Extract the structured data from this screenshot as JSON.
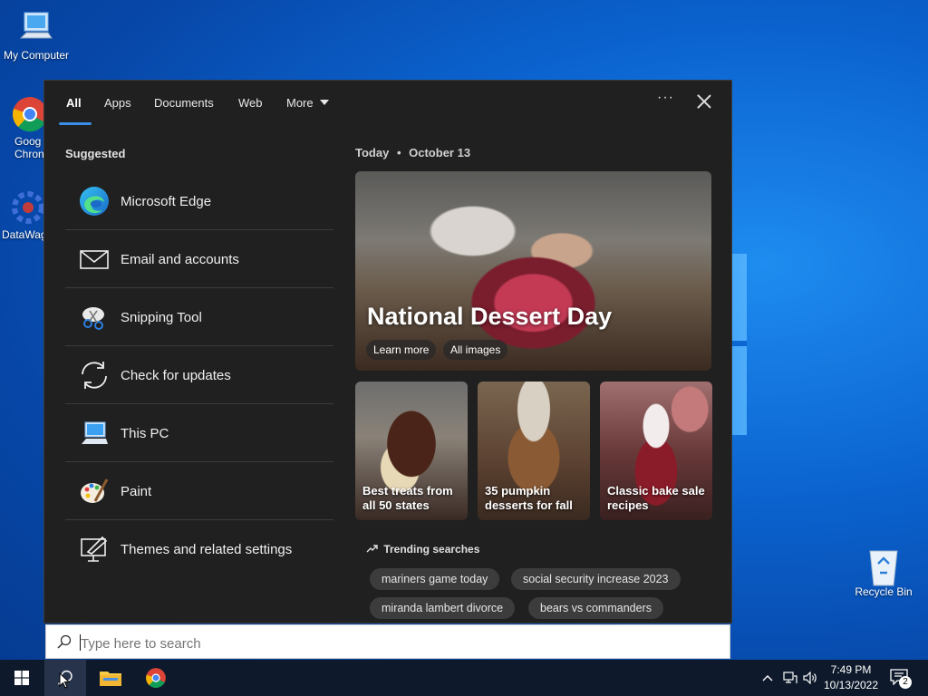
{
  "desktop": {
    "icons": [
      {
        "label": "My Computer",
        "icon": "computer-icon"
      },
      {
        "label": "Goog\nChron",
        "icon": "chrome-icon"
      },
      {
        "label": "DataWag",
        "icon": "datawag-icon"
      },
      {
        "label": "Recycle Bin",
        "icon": "recycle-bin-icon"
      }
    ]
  },
  "tabs": [
    {
      "label": "All",
      "active": true
    },
    {
      "label": "Apps"
    },
    {
      "label": "Documents"
    },
    {
      "label": "Web"
    },
    {
      "label": "More"
    }
  ],
  "more_menu_icon": "ellipsis-icon",
  "suggested": {
    "title": "Suggested",
    "items": [
      {
        "label": "Microsoft Edge",
        "icon": "edge-icon"
      },
      {
        "label": "Email and accounts",
        "icon": "mail-icon"
      },
      {
        "label": "Snipping Tool",
        "icon": "snipping-tool-icon"
      },
      {
        "label": "Check for updates",
        "icon": "sync-icon"
      },
      {
        "label": "This PC",
        "icon": "computer-icon"
      },
      {
        "label": "Paint",
        "icon": "paint-icon"
      },
      {
        "label": "Themes and related settings",
        "icon": "themes-icon"
      }
    ]
  },
  "today": {
    "label": "Today",
    "separator": "•",
    "date": "October 13",
    "hero": {
      "title": "National Dessert Day",
      "buttons": [
        "Learn more",
        "All images"
      ]
    },
    "cards": [
      {
        "caption": "Best treats from all 50 states"
      },
      {
        "caption": "35 pumpkin desserts for fall"
      },
      {
        "caption": "Classic bake sale recipes"
      }
    ]
  },
  "trending": {
    "title": "Trending searches",
    "items": [
      "mariners game today",
      "social security increase 2023",
      "miranda lambert divorce",
      "bears vs commanders"
    ]
  },
  "search": {
    "placeholder": "Type here to search"
  },
  "taskbar": {
    "time": "7:49 PM",
    "date": "10/13/2022",
    "notification_count": "2"
  },
  "colors": {
    "panel_bg": "#202020",
    "accent": "#3a8ee6",
    "taskbar_bg": "#0e1a2b"
  }
}
